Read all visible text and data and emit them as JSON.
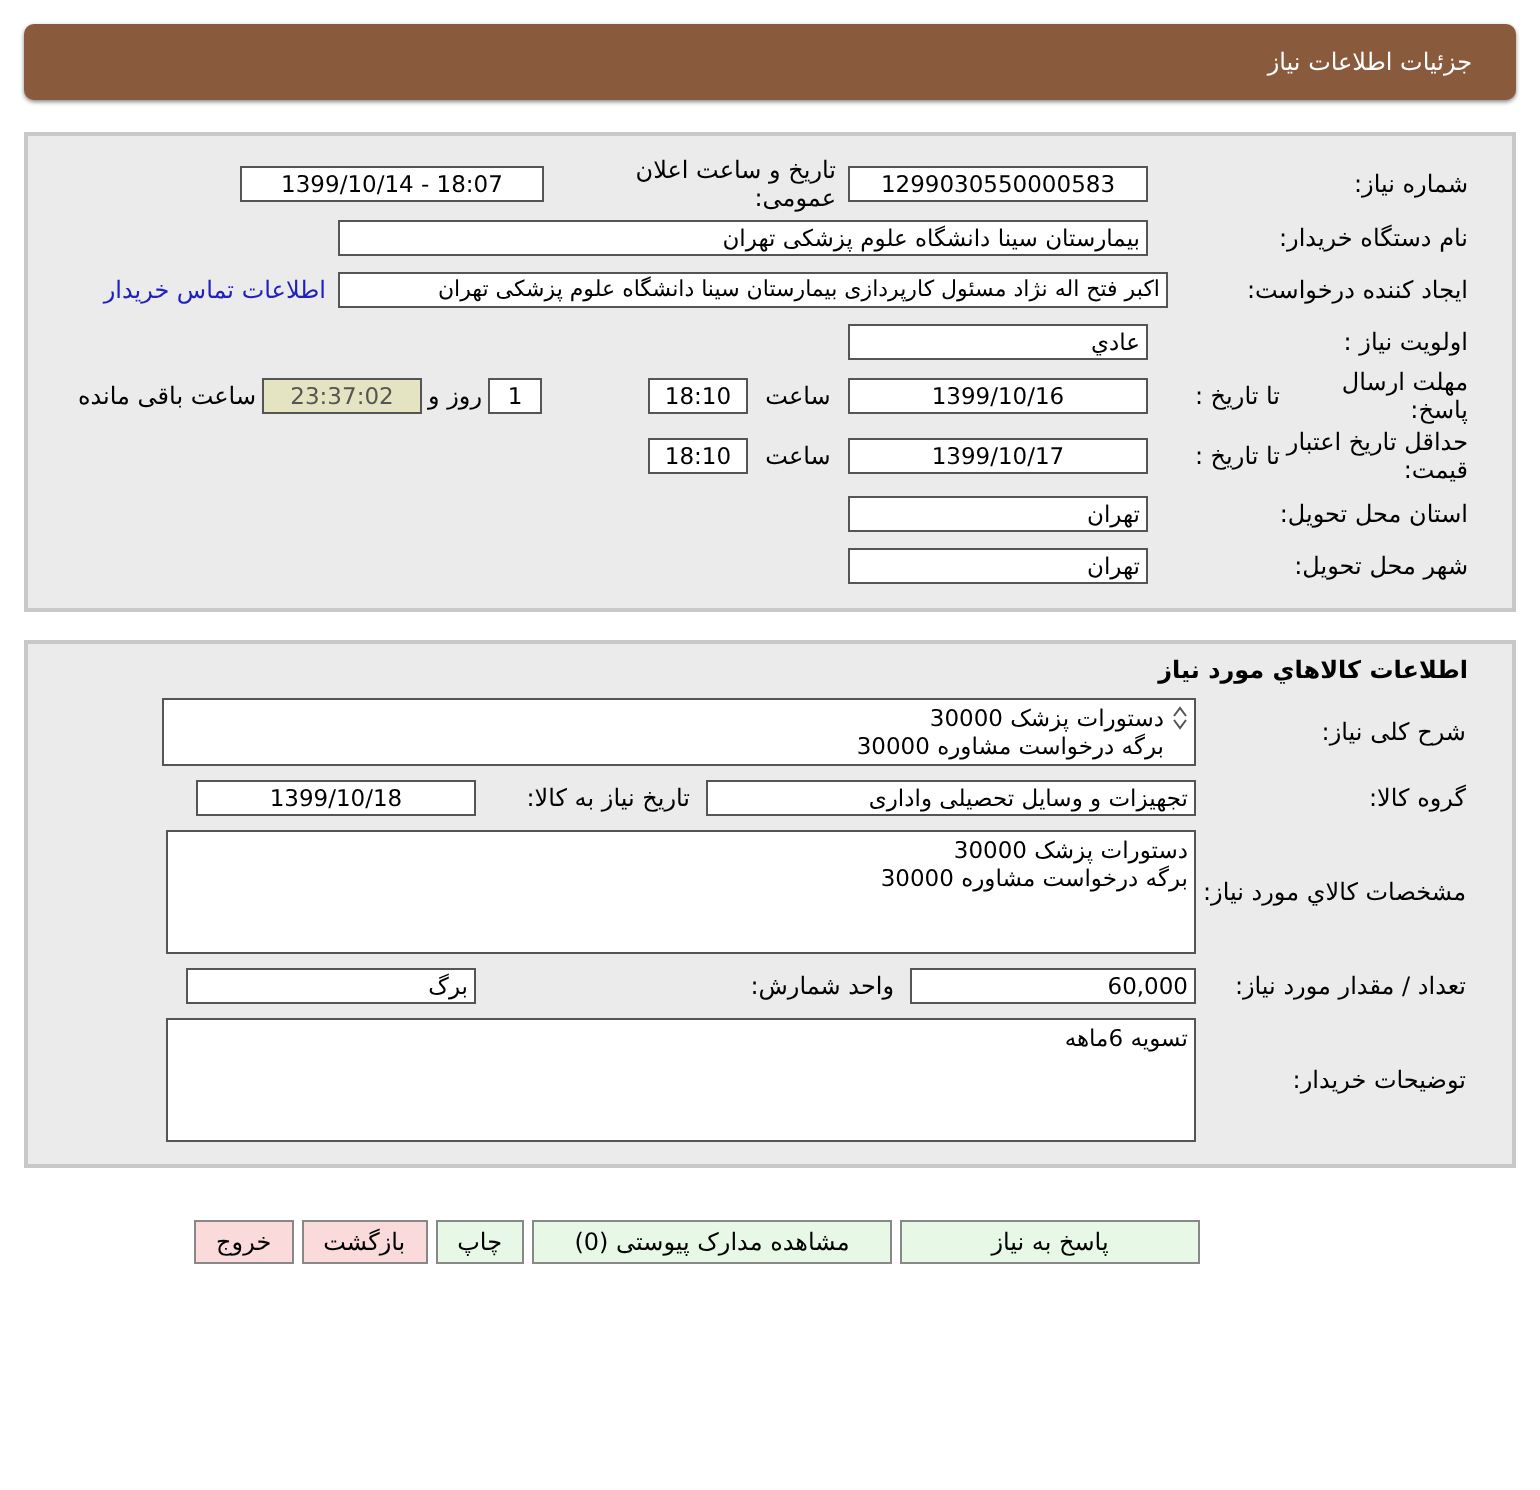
{
  "header": {
    "title": "جزئیات اطلاعات نیاز"
  },
  "details": {
    "need_number": {
      "label": "شماره نیاز:",
      "value": "1299030550000583"
    },
    "announce": {
      "label": "تاریخ و ساعت اعلان عمومی:",
      "value": "1399/10/14 - 18:07"
    },
    "buyer_org": {
      "label": "نام دستگاه خریدار:",
      "value": "بیمارستان سینا دانشگاه علوم پزشکی تهران"
    },
    "requester": {
      "label": "ایجاد کننده درخواست:",
      "value": "اکبر  فتح اله نژاد  مسئول کارپردازی  بیمارستان سینا دانشگاه علوم پزشکی تهران",
      "link": "اطلاعات تماس خریدار"
    },
    "priority": {
      "label": "اولویت نیاز :",
      "value": "عادي"
    },
    "response_deadline": {
      "label": "مهلت ارسال پاسخ:",
      "date_label": "تا تاریخ :",
      "date": "1399/10/16",
      "time_label": "ساعت",
      "time": "18:10",
      "days": "1",
      "days_label": "روز و",
      "remaining": "23:37:02",
      "remaining_label": "ساعت باقی مانده"
    },
    "price_validity": {
      "label": "حداقل تاریخ اعتبار قیمت:",
      "date_label": "تا تاریخ :",
      "date": "1399/10/17",
      "time_label": "ساعت",
      "time": "18:10"
    },
    "province": {
      "label": "استان محل تحویل:",
      "value": "تهران"
    },
    "city": {
      "label": "شهر محل تحویل:",
      "value": "تهران"
    }
  },
  "goods": {
    "title": "اطلاعات کالاهاي مورد نياز",
    "summary": {
      "label": "شرح کلی نیاز:",
      "lines": [
        "دستورات پزشک 30000",
        "برگه درخواست مشاوره 30000"
      ]
    },
    "group": {
      "label": "گروه کالا:",
      "value": "تجهیزات و وسایل تحصیلی واداری"
    },
    "need_date": {
      "label": "تاریخ نیاز به کالا:",
      "value": "1399/10/18"
    },
    "specs": {
      "label": "مشخصات کالاي مورد نياز:",
      "lines": [
        "دستورات پزشک 30000",
        "برگه درخواست مشاوره 30000"
      ]
    },
    "quantity": {
      "label": "تعداد / مقدار مورد نیاز:",
      "value": "60,000"
    },
    "unit": {
      "label": "واحد شمارش:",
      "value": "برگ"
    },
    "notes": {
      "label": "توضیحات خریدار:",
      "value": "تسویه 6ماهه"
    }
  },
  "buttons": [
    {
      "label": "پاسخ به نیاز",
      "kind": "action"
    },
    {
      "label": "مشاهده مدارک پیوستی (0)",
      "kind": "action"
    },
    {
      "label": "چاپ",
      "kind": "action"
    },
    {
      "label": "بازگشت",
      "kind": "nav"
    },
    {
      "label": "خروج",
      "kind": "nav"
    }
  ]
}
